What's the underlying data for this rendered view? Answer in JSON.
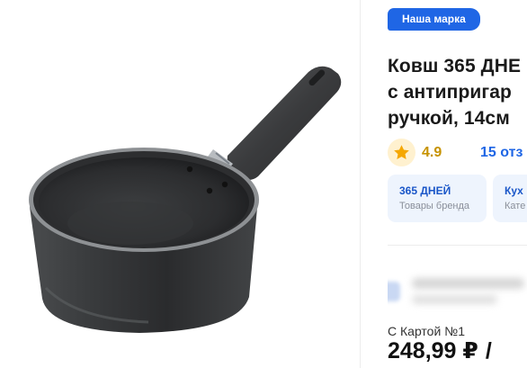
{
  "product": {
    "brand_badge": "Наша марка",
    "title_lines": [
      "Ковш 365 ДНЕ",
      "с антипригар",
      "ручкой, 14см"
    ]
  },
  "rating": {
    "icon": "star-icon",
    "value": "4.9",
    "reviews": "15 отз"
  },
  "chips": [
    {
      "title": "365 ДНЕЙ",
      "subtitle": "Товары бренда"
    },
    {
      "title": "Кух",
      "subtitle": "Кате"
    }
  ],
  "price": {
    "card_label": "С Картой №1",
    "value": "248,99 ₽",
    "separator": "/"
  },
  "colors": {
    "accent": "#1f66e5",
    "rating": "#c69200",
    "star": "#f5a700",
    "chip_bg": "#eef4fd"
  }
}
